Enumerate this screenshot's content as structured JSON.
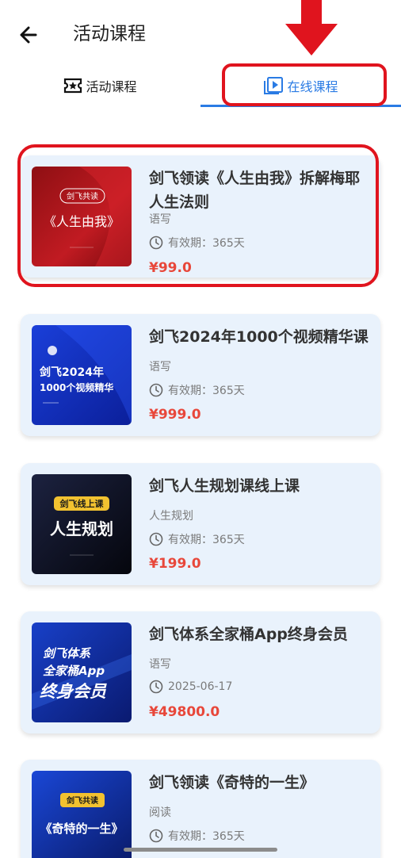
{
  "header": {
    "title": "活动课程",
    "back_icon": "arrow-left-icon"
  },
  "tabs": [
    {
      "label": "活动课程",
      "icon": "ticket-icon",
      "active": false
    },
    {
      "label": "在线课程",
      "icon": "video-play-icon",
      "active": true
    }
  ],
  "colors": {
    "accent": "#2a7be4",
    "price": "#e8473a",
    "card_bg": "#e9f2fc",
    "annotation": "#e0141e"
  },
  "courses": [
    {
      "title": "剑飞领读《人生由我》拆解梅耶人生法则",
      "category": "语写",
      "validity": "有效期：365天",
      "price": "¥99.0",
      "thumb": {
        "badge": "剑飞共读",
        "main": "《人生由我》"
      }
    },
    {
      "title": "剑飞2024年1000个视频精华课",
      "category": "语写",
      "validity": "有效期：365天",
      "price": "¥999.0",
      "thumb": {
        "line1": "剑飞2024年",
        "line2": "1000个视频精华"
      }
    },
    {
      "title": "剑飞人生规划课线上课",
      "category": "人生规划",
      "validity": "有效期：365天",
      "price": "¥199.0",
      "thumb": {
        "badge": "剑飞线上课",
        "main": "人生规划"
      }
    },
    {
      "title": "剑飞体系全家桶App终身会员",
      "category": "语写",
      "validity": "2025-06-17",
      "price": "¥49800.0",
      "thumb": {
        "line1": "剑飞体系",
        "line2": "全家桶App",
        "line3": "终身会员"
      }
    },
    {
      "title": "剑飞领读《奇特的一生》",
      "category": "阅读",
      "validity": "有效期：365天",
      "price": "",
      "thumb": {
        "badge": "剑飞共读",
        "main": "《奇特的一生》"
      }
    }
  ]
}
